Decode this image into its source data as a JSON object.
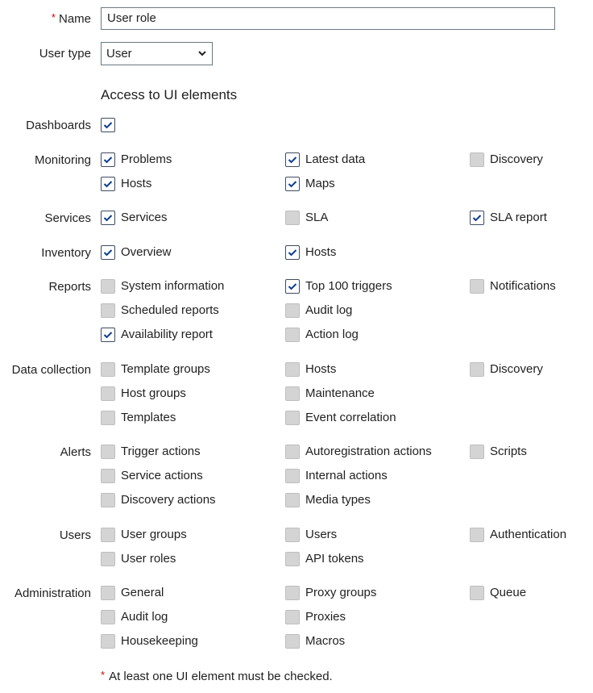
{
  "form": {
    "name_label": "Name",
    "required_mark": "*",
    "name_value": "User role",
    "user_type_label": "User type",
    "user_type_value": "User",
    "access_title": "Access to UI elements",
    "footnote": "At least one UI element must be checked."
  },
  "colors": {
    "required": "#d40000",
    "check": "#0b3d91",
    "input_border": "#6a7880"
  },
  "groups": [
    {
      "label": "Dashboards",
      "items": [
        {
          "label": "",
          "checked": true,
          "col": 0,
          "row": 0
        }
      ]
    },
    {
      "label": "Monitoring",
      "items": [
        {
          "label": "Problems",
          "checked": true,
          "col": 0,
          "row": 0
        },
        {
          "label": "Latest data",
          "checked": true,
          "col": 1,
          "row": 0
        },
        {
          "label": "Discovery",
          "checked": false,
          "col": 2,
          "row": 0
        },
        {
          "label": "Hosts",
          "checked": true,
          "col": 0,
          "row": 1
        },
        {
          "label": "Maps",
          "checked": true,
          "col": 1,
          "row": 1
        }
      ]
    },
    {
      "label": "Services",
      "items": [
        {
          "label": "Services",
          "checked": true,
          "col": 0,
          "row": 0
        },
        {
          "label": "SLA",
          "checked": false,
          "col": 1,
          "row": 0
        },
        {
          "label": "SLA report",
          "checked": true,
          "col": 2,
          "row": 0
        }
      ]
    },
    {
      "label": "Inventory",
      "items": [
        {
          "label": "Overview",
          "checked": true,
          "col": 0,
          "row": 0
        },
        {
          "label": "Hosts",
          "checked": true,
          "col": 1,
          "row": 0
        }
      ]
    },
    {
      "label": "Reports",
      "items": [
        {
          "label": "System information",
          "checked": false,
          "col": 0,
          "row": 0
        },
        {
          "label": "Top 100 triggers",
          "checked": true,
          "col": 1,
          "row": 0
        },
        {
          "label": "Notifications",
          "checked": false,
          "col": 2,
          "row": 0
        },
        {
          "label": "Scheduled reports",
          "checked": false,
          "col": 0,
          "row": 1
        },
        {
          "label": "Audit log",
          "checked": false,
          "col": 1,
          "row": 1
        },
        {
          "label": "Availability report",
          "checked": true,
          "col": 0,
          "row": 2
        },
        {
          "label": "Action log",
          "checked": false,
          "col": 1,
          "row": 2
        }
      ]
    },
    {
      "label": "Data collection",
      "items": [
        {
          "label": "Template groups",
          "checked": false,
          "col": 0,
          "row": 0
        },
        {
          "label": "Hosts",
          "checked": false,
          "col": 1,
          "row": 0
        },
        {
          "label": "Discovery",
          "checked": false,
          "col": 2,
          "row": 0
        },
        {
          "label": "Host groups",
          "checked": false,
          "col": 0,
          "row": 1
        },
        {
          "label": "Maintenance",
          "checked": false,
          "col": 1,
          "row": 1
        },
        {
          "label": "Templates",
          "checked": false,
          "col": 0,
          "row": 2
        },
        {
          "label": "Event correlation",
          "checked": false,
          "col": 1,
          "row": 2
        }
      ]
    },
    {
      "label": "Alerts",
      "items": [
        {
          "label": "Trigger actions",
          "checked": false,
          "col": 0,
          "row": 0
        },
        {
          "label": "Autoregistration actions",
          "checked": false,
          "col": 1,
          "row": 0
        },
        {
          "label": "Scripts",
          "checked": false,
          "col": 2,
          "row": 0
        },
        {
          "label": "Service actions",
          "checked": false,
          "col": 0,
          "row": 1
        },
        {
          "label": "Internal actions",
          "checked": false,
          "col": 1,
          "row": 1
        },
        {
          "label": "Discovery actions",
          "checked": false,
          "col": 0,
          "row": 2
        },
        {
          "label": "Media types",
          "checked": false,
          "col": 1,
          "row": 2
        }
      ]
    },
    {
      "label": "Users",
      "items": [
        {
          "label": "User groups",
          "checked": false,
          "col": 0,
          "row": 0
        },
        {
          "label": "Users",
          "checked": false,
          "col": 1,
          "row": 0
        },
        {
          "label": "Authentication",
          "checked": false,
          "col": 2,
          "row": 0
        },
        {
          "label": "User roles",
          "checked": false,
          "col": 0,
          "row": 1
        },
        {
          "label": "API tokens",
          "checked": false,
          "col": 1,
          "row": 1
        }
      ]
    },
    {
      "label": "Administration",
      "items": [
        {
          "label": "General",
          "checked": false,
          "col": 0,
          "row": 0
        },
        {
          "label": "Proxy groups",
          "checked": false,
          "col": 1,
          "row": 0
        },
        {
          "label": "Queue",
          "checked": false,
          "col": 2,
          "row": 0
        },
        {
          "label": "Audit log",
          "checked": false,
          "col": 0,
          "row": 1
        },
        {
          "label": "Proxies",
          "checked": false,
          "col": 1,
          "row": 1
        },
        {
          "label": "Housekeeping",
          "checked": false,
          "col": 0,
          "row": 2
        },
        {
          "label": "Macros",
          "checked": false,
          "col": 1,
          "row": 2
        }
      ]
    }
  ]
}
